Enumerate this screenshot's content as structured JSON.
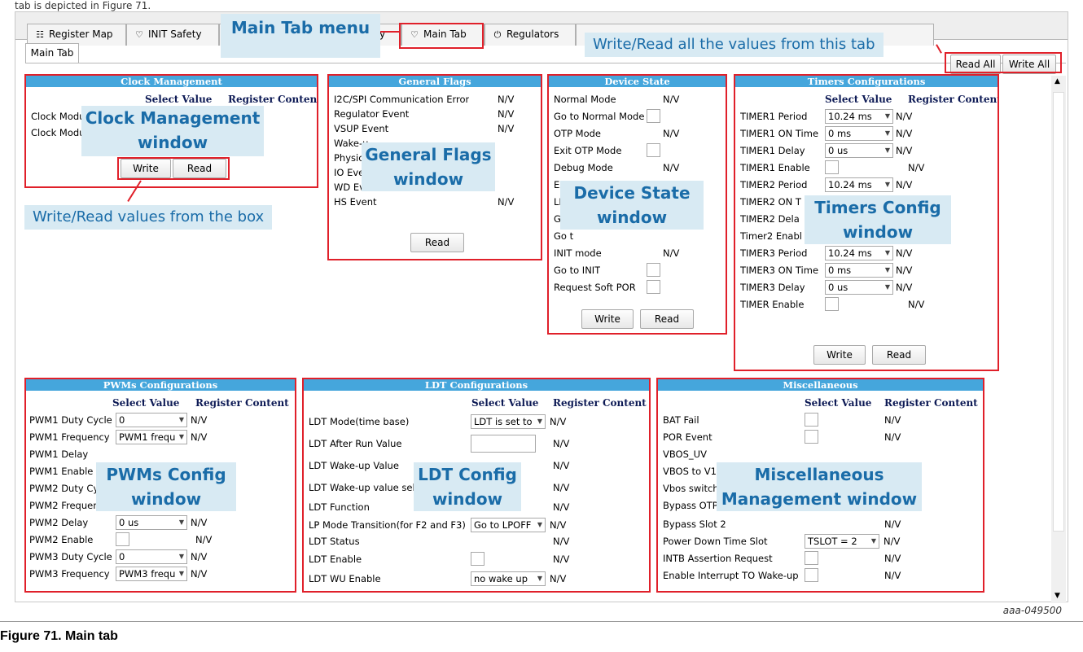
{
  "top_text": "tab is depicted in Figure 71.",
  "tabs": [
    {
      "icon": "register-map-icon",
      "glyph": "☷",
      "label": "Register Map"
    },
    {
      "icon": "shield-icon",
      "glyph": "♡",
      "label": "INIT Safety"
    },
    {
      "icon": "shield-icon",
      "glyph": "♡",
      "label": "y"
    },
    {
      "icon": "shield-icon",
      "glyph": "♡",
      "label": "Main Tab"
    },
    {
      "icon": "power-icon",
      "glyph": "⏻",
      "label": "Regulators"
    }
  ],
  "subtab": "Main Tab",
  "buttons": {
    "read_all": "Read All",
    "write_all": "Write All",
    "write": "Write",
    "read": "Read"
  },
  "callouts": {
    "main_tab_menu": "Main Tab menu",
    "write_read_all": "Write/Read all the values from this tab",
    "write_read_box": "Write/Read values from the box",
    "clock": "Clock Management window",
    "flags": "General Flags window",
    "device": "Device State window",
    "timers": "Timers Config window",
    "pwms": "PWMs Config window",
    "ldt": "LDT Config window",
    "misc": "Miscellaneous Management window"
  },
  "headers": {
    "select_value": "Select Value",
    "register_content": "Register Content",
    "nv": "N/V"
  },
  "clock": {
    "title": "Clock Management",
    "rows": [
      "Clock Modu",
      "Clock Modu"
    ]
  },
  "flags": {
    "title": "General Flags",
    "rows": [
      {
        "label": "I2C/SPI Communication Error",
        "value": "N/V"
      },
      {
        "label": "Regulator Event",
        "value": "N/V"
      },
      {
        "label": "VSUP Event",
        "value": "N/V"
      },
      {
        "label": "Wake-u",
        "value": ""
      },
      {
        "label": "Physica",
        "value": ""
      },
      {
        "label": "IO Even",
        "value": ""
      },
      {
        "label": "WD Eve",
        "value": ""
      },
      {
        "label": "HS Event",
        "value": "N/V"
      }
    ]
  },
  "device": {
    "title": "Device State",
    "rows": [
      {
        "label": "Normal Mode",
        "cb": false,
        "value": "N/V"
      },
      {
        "label": "Go to Normal Mode",
        "cb": true,
        "value": ""
      },
      {
        "label": "OTP Mode",
        "cb": false,
        "value": "N/V"
      },
      {
        "label": "Exit OTP Mode",
        "cb": true,
        "value": ""
      },
      {
        "label": "Debug Mode",
        "cb": false,
        "value": "N/V"
      },
      {
        "label": "Exit",
        "cb": false,
        "value": ""
      },
      {
        "label": "LPC",
        "cb": false,
        "value": ""
      },
      {
        "label": "Go t",
        "cb": false,
        "value": ""
      },
      {
        "label": "Go t",
        "cb": false,
        "value": ""
      },
      {
        "label": "INIT mode",
        "cb": false,
        "value": "N/V"
      },
      {
        "label": "Go to INIT",
        "cb": true,
        "value": ""
      },
      {
        "label": "Request Soft POR",
        "cb": true,
        "value": ""
      }
    ]
  },
  "timers": {
    "title": "Timers Configurations",
    "rows": [
      {
        "label": "TIMER1 Period",
        "control": "dd",
        "sel": "10.24 ms",
        "value": "N/V"
      },
      {
        "label": "TIMER1 ON Time",
        "control": "dd",
        "sel": "0 ms",
        "value": "N/V"
      },
      {
        "label": "TIMER1 Delay",
        "control": "dd",
        "sel": "0 us",
        "value": "N/V"
      },
      {
        "label": "TIMER1 Enable",
        "control": "cb",
        "sel": "",
        "value": "N/V"
      },
      {
        "label": "TIMER2 Period",
        "control": "dd",
        "sel": "10.24 ms",
        "value": "N/V"
      },
      {
        "label": "TIMER2 ON T",
        "control": "none",
        "sel": "",
        "value": ""
      },
      {
        "label": "TIMER2 Dela",
        "control": "none",
        "sel": "",
        "value": ""
      },
      {
        "label": "Timer2 Enabl",
        "control": "none",
        "sel": "",
        "value": ""
      },
      {
        "label": "TIMER3 Period",
        "control": "dd",
        "sel": "10.24 ms",
        "value": "N/V"
      },
      {
        "label": "TIMER3 ON Time",
        "control": "dd",
        "sel": "0 ms",
        "value": "N/V"
      },
      {
        "label": "TIMER3 Delay",
        "control": "dd",
        "sel": "0 us",
        "value": "N/V"
      },
      {
        "label": "TIMER Enable",
        "control": "cb",
        "sel": "",
        "value": "N/V"
      }
    ]
  },
  "pwms": {
    "title": "PWMs Configurations",
    "rows": [
      {
        "label": "PWM1 Duty Cycle",
        "control": "dd",
        "sel": "0",
        "value": "N/V"
      },
      {
        "label": "PWM1 Frequency",
        "control": "dd",
        "sel": "PWM1 frequ",
        "value": "N/V"
      },
      {
        "label": "PWM1 Delay",
        "control": "none",
        "sel": "",
        "value": ""
      },
      {
        "label": "PWM1 Enable",
        "control": "none",
        "sel": "",
        "value": ""
      },
      {
        "label": "PWM2 Duty Cy",
        "control": "none",
        "sel": "",
        "value": ""
      },
      {
        "label": "PWM2 Frequen",
        "control": "none",
        "sel": "",
        "value": ""
      },
      {
        "label": "PWM2 Delay",
        "control": "dd",
        "sel": "0 us",
        "value": "N/V"
      },
      {
        "label": "PWM2 Enable",
        "control": "cb",
        "sel": "",
        "value": "N/V"
      },
      {
        "label": "PWM3 Duty Cycle",
        "control": "dd",
        "sel": "0",
        "value": "N/V"
      },
      {
        "label": "PWM3 Frequency",
        "control": "dd",
        "sel": "PWM3 frequ",
        "value": "N/V"
      }
    ]
  },
  "ldt": {
    "title": "LDT Configurations",
    "rows": [
      {
        "label": "LDT Mode(time base)",
        "control": "dd",
        "sel": "LDT is set to",
        "value": "N/V"
      },
      {
        "label": "LDT After Run Value",
        "control": "inp",
        "sel": "",
        "value": "N/V"
      },
      {
        "label": "LDT Wake-up Value",
        "control": "none",
        "sel": "",
        "value": "N/V"
      },
      {
        "label": "LDT Wake-up value sel",
        "control": "none",
        "sel": "",
        "value": "N/V"
      },
      {
        "label": "LDT Function",
        "control": "none",
        "sel": "",
        "value": "N/V"
      },
      {
        "label": "LP Mode Transition(for F2 and F3)",
        "control": "dd",
        "sel": "Go to LPOFF",
        "value": "N/V"
      },
      {
        "label": "LDT Status",
        "control": "none",
        "sel": "",
        "value": "N/V"
      },
      {
        "label": "LDT Enable",
        "control": "cb",
        "sel": "",
        "value": "N/V"
      },
      {
        "label": "LDT WU Enable",
        "control": "dd",
        "sel": "no wake up",
        "value": "N/V"
      }
    ]
  },
  "misc": {
    "title": "Miscellaneous",
    "rows": [
      {
        "label": "BAT Fail",
        "control": "cb",
        "sel": "",
        "value": "N/V"
      },
      {
        "label": "POR Event",
        "control": "cb",
        "sel": "",
        "value": "N/V"
      },
      {
        "label": "VBOS_UV",
        "control": "none",
        "sel": "",
        "value": ""
      },
      {
        "label": "VBOS to V1",
        "control": "none",
        "sel": "",
        "value": ""
      },
      {
        "label": "Vbos switch",
        "control": "none",
        "sel": "",
        "value": ""
      },
      {
        "label": "Bypass OTP",
        "control": "none",
        "sel": "",
        "value": ""
      },
      {
        "label": "Bypass Slot 2",
        "control": "none",
        "sel": "",
        "value": "N/V"
      },
      {
        "label": "Power Down Time Slot",
        "control": "dd",
        "sel": "TSLOT = 2",
        "value": "N/V"
      },
      {
        "label": "INTB Assertion Request",
        "control": "cb",
        "sel": "",
        "value": "N/V"
      },
      {
        "label": "Enable Interrupt TO Wake-up",
        "control": "cb",
        "sel": "",
        "value": "N/V"
      }
    ]
  },
  "figure_id": "aaa-049500",
  "caption": "Figure 71.  Main tab"
}
